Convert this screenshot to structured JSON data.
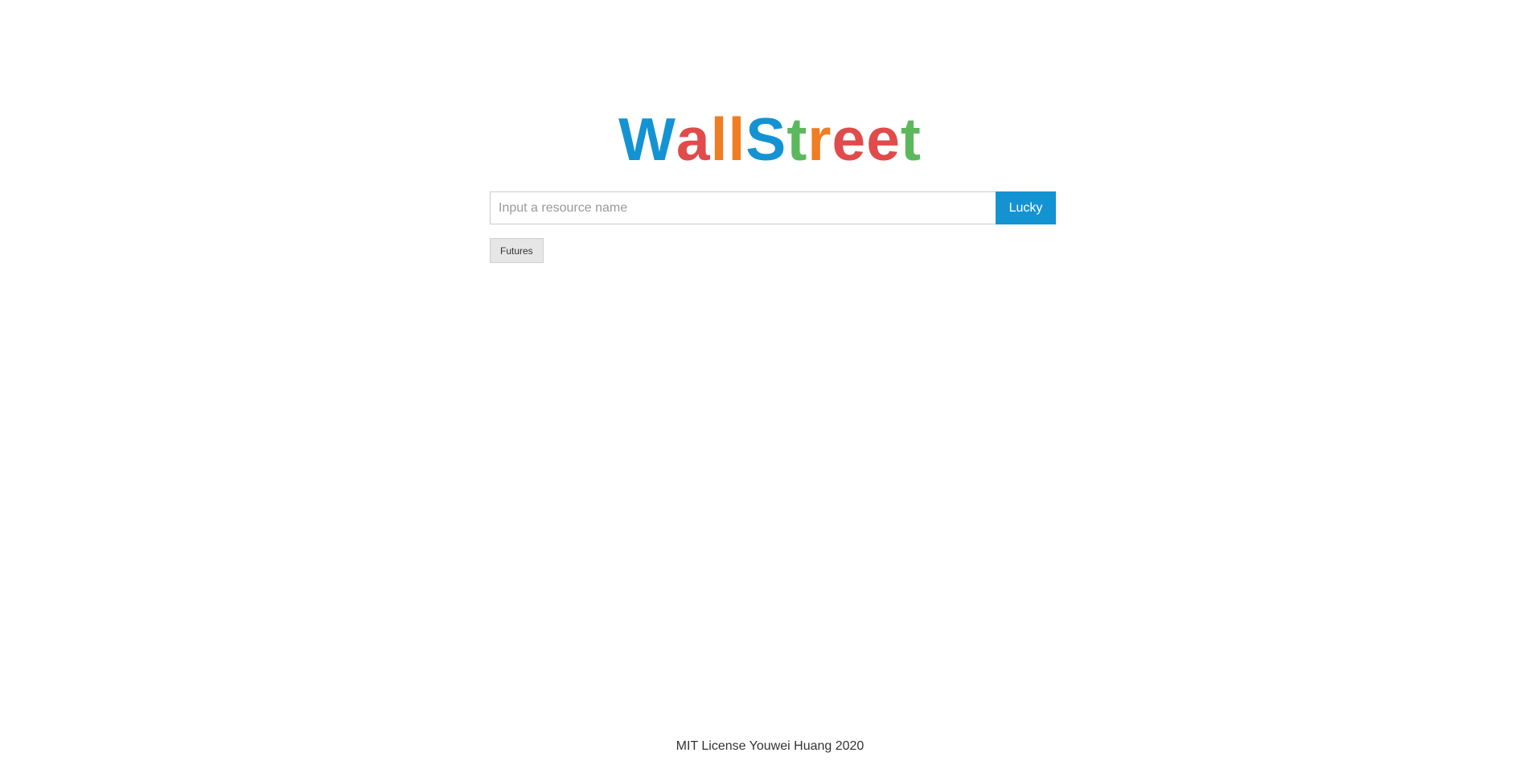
{
  "logo": {
    "letters": [
      {
        "char": "W",
        "color": "#1493d3"
      },
      {
        "char": "a",
        "color": "#e04b4b"
      },
      {
        "char": "l",
        "color": "#f07d22"
      },
      {
        "char": "l",
        "color": "#f07d22"
      },
      {
        "char": "S",
        "color": "#1493d3"
      },
      {
        "char": "t",
        "color": "#5cb85c"
      },
      {
        "char": "r",
        "color": "#f07d22"
      },
      {
        "char": "e",
        "color": "#e04b4b"
      },
      {
        "char": "e",
        "color": "#e04b4b"
      },
      {
        "char": "t",
        "color": "#5cb85c"
      }
    ]
  },
  "search": {
    "placeholder": "Input a resource name",
    "value": "",
    "button_label": "Lucky"
  },
  "tags": [
    {
      "label": "Futures"
    }
  ],
  "footer": {
    "text": "MIT License Youwei Huang 2020"
  },
  "colors": {
    "accent": "#1493d3"
  }
}
